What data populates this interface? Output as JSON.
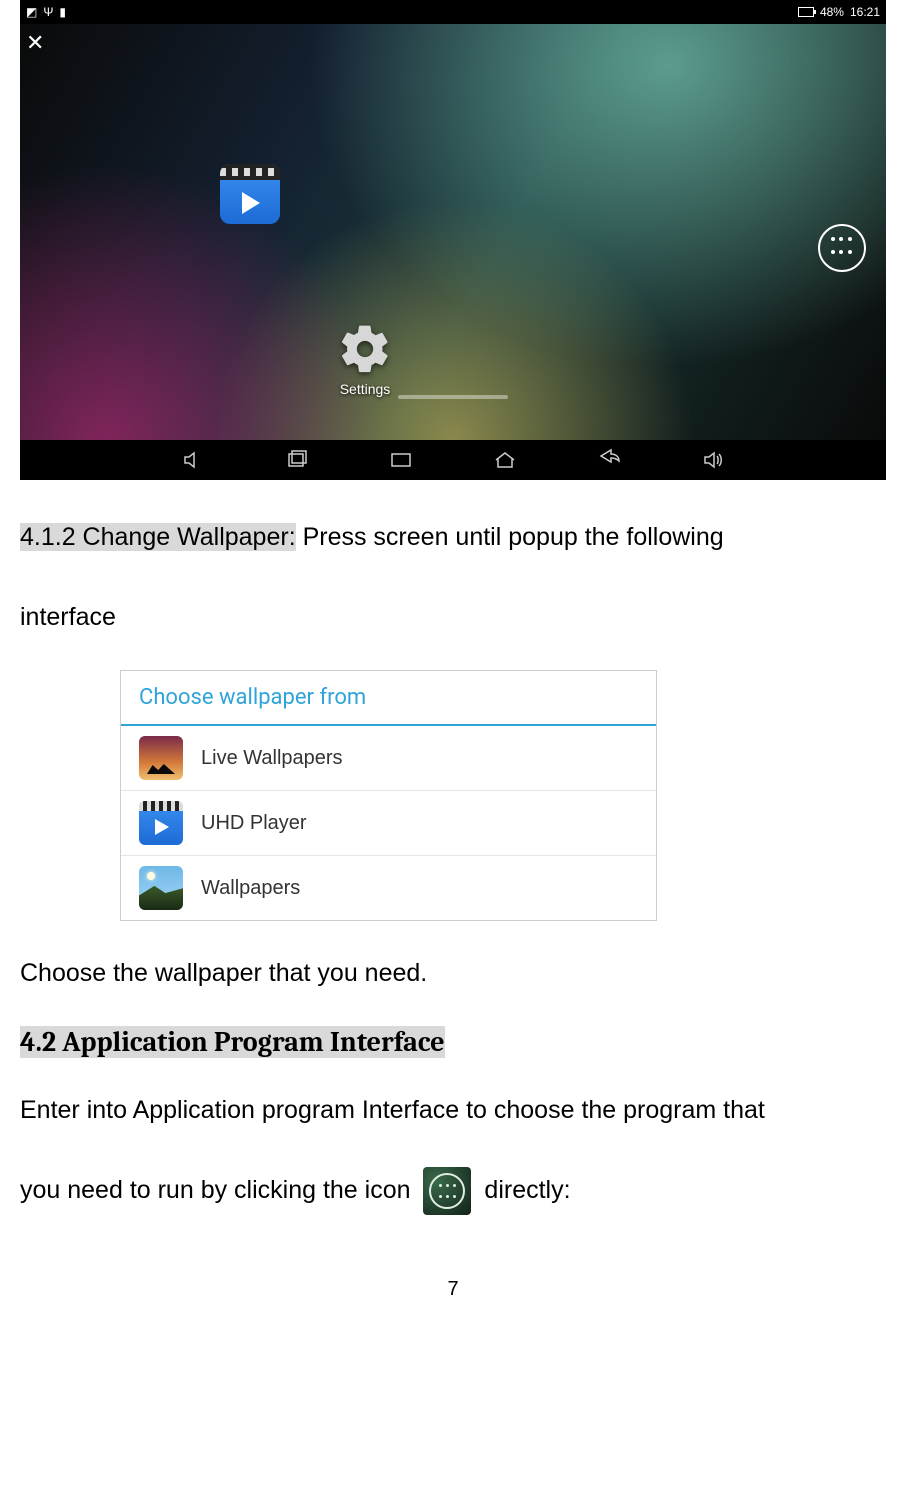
{
  "statusbar": {
    "battery_pct": "48%",
    "clock": "16:21"
  },
  "homescreen": {
    "settings_label": "Settings"
  },
  "dialog": {
    "title": "Choose wallpaper from",
    "items": [
      {
        "label": "Live Wallpapers"
      },
      {
        "label": "UHD Player"
      },
      {
        "label": "Wallpapers"
      }
    ]
  },
  "text": {
    "sec412_label": "4.1.2  Change  Wallpaper:",
    "sec412_rest_a": "  Press  screen  until  popup  the  following",
    "sec412_rest_b": "interface",
    "choose_line": "Choose the wallpaper that you need.",
    "sec42_head": "4.2 Application Program Interface",
    "api_line1": "Enter into Application program Interface to choose the program that",
    "api_line2a": "you need to run by clicking the icon ",
    "api_line2b": "  directly:"
  },
  "page_number": "7"
}
